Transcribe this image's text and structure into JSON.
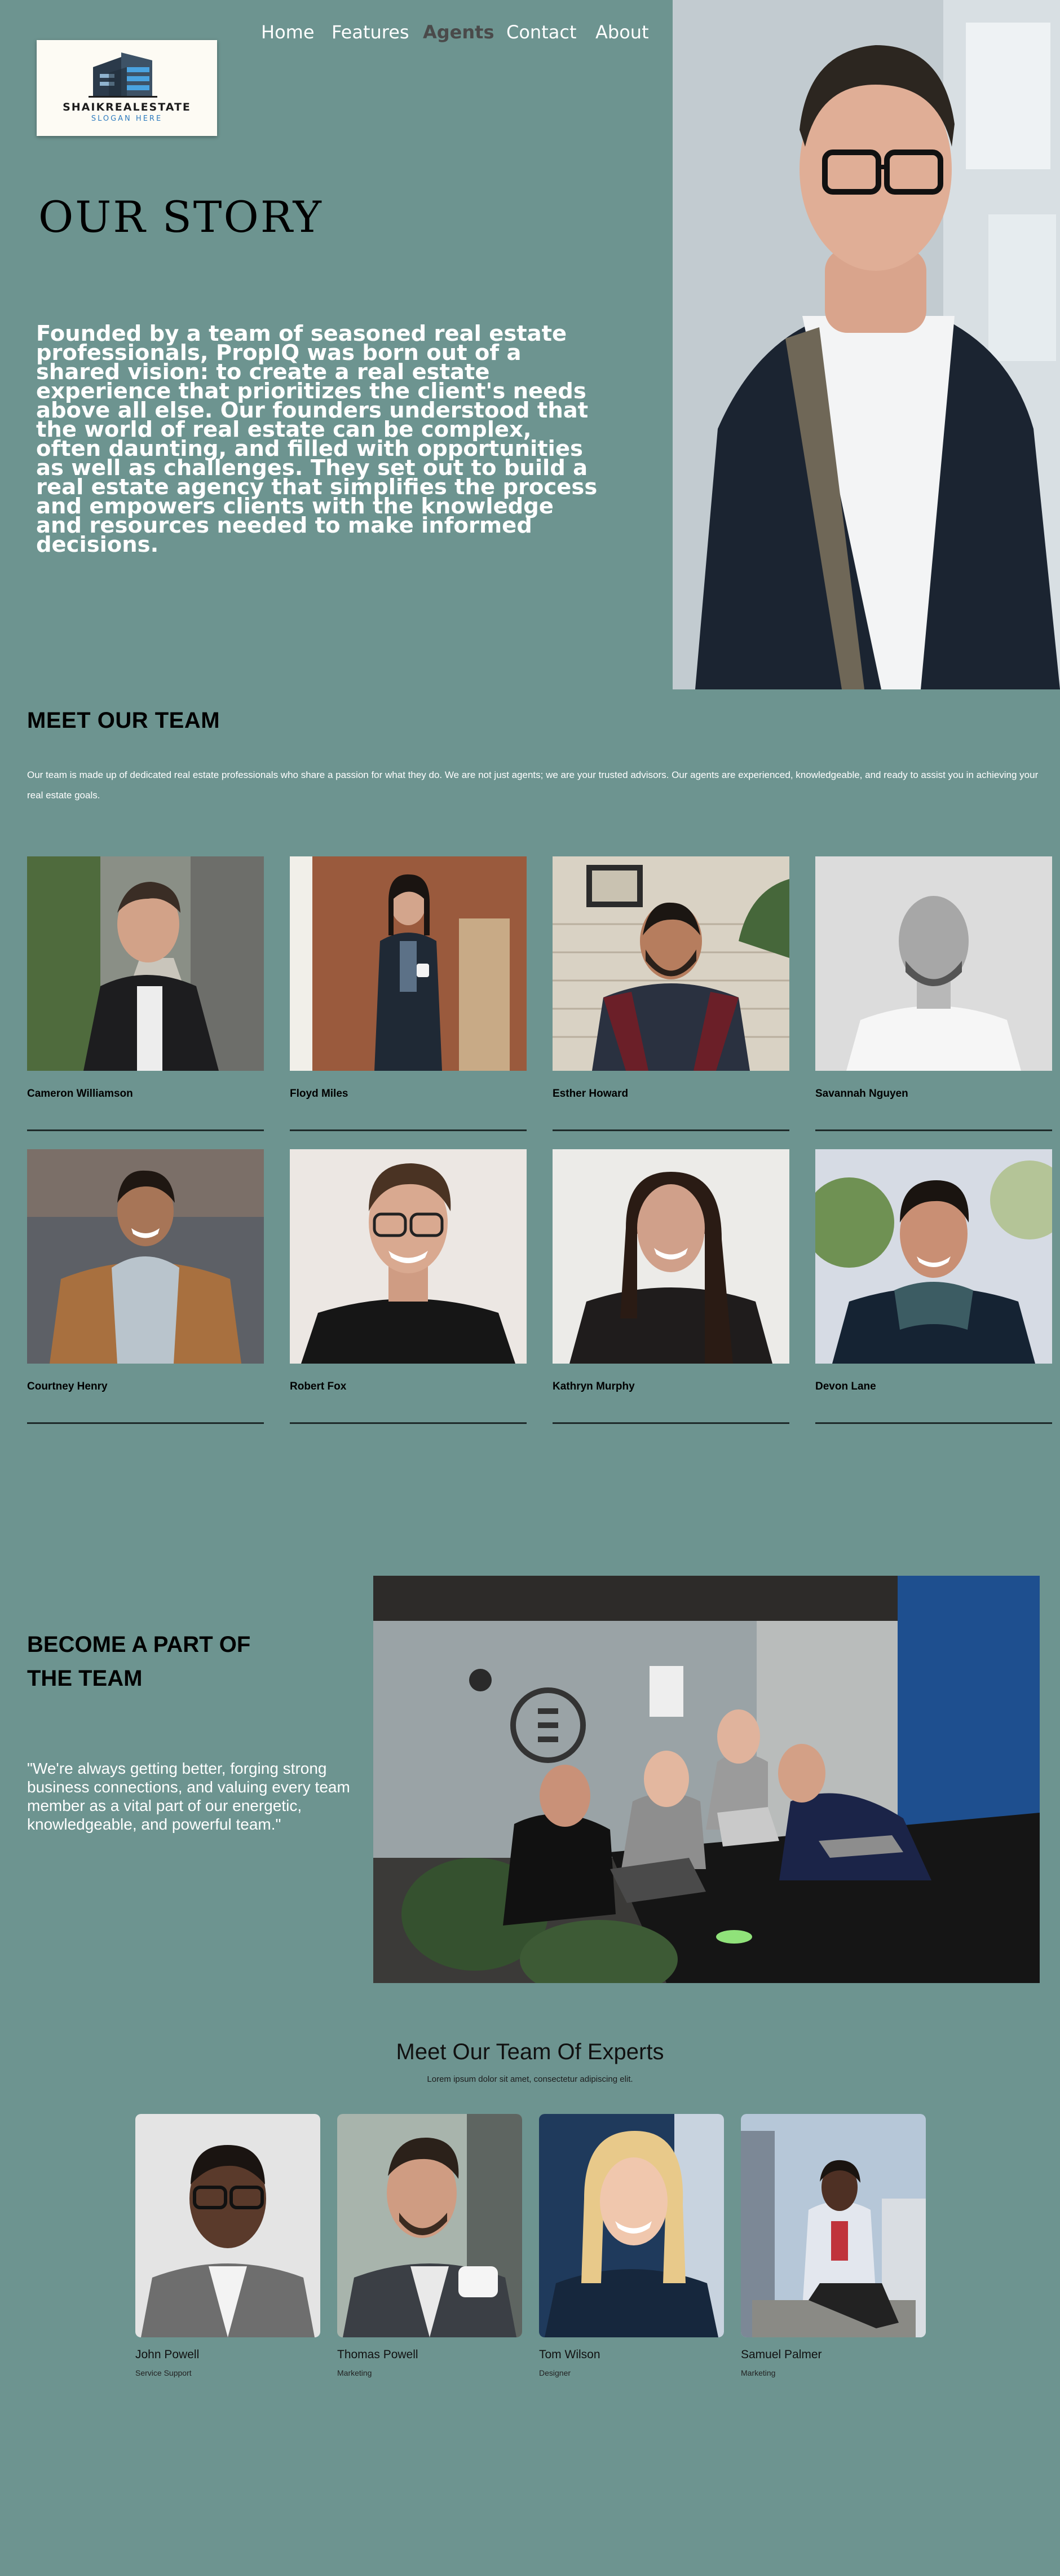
{
  "brand": {
    "name": "SHAIKREALESTATE",
    "slogan": "SLOGAN HERE"
  },
  "nav": {
    "items": [
      {
        "label": "Home",
        "active": false
      },
      {
        "label": "Features",
        "active": false
      },
      {
        "label": "Agents",
        "active": true
      },
      {
        "label": "Contact",
        "active": false
      },
      {
        "label": "About",
        "active": false
      }
    ]
  },
  "hero": {
    "title": "OUR STORY",
    "text": "Founded by a team of seasoned real estate professionals, PropIQ was born out of a shared vision: to create a real estate experience that prioritizes the client's needs above all else. Our founders understood that the world of real estate can be complex, often daunting, and filled with opportunities as well as challenges. They set out to build a real estate agency that simplifies the process and empowers clients with the knowledge and resources needed to make informed decisions."
  },
  "team": {
    "title": "MEET OUR TEAM",
    "description": "Our team is made up of dedicated real estate professionals who share a passion for what they do. We are not just agents; we are your trusted advisors. Our agents are experienced, knowledgeable, and ready to assist you in achieving your real estate goals.",
    "agents": [
      {
        "name": "Cameron Williamson"
      },
      {
        "name": "Floyd Miles"
      },
      {
        "name": "Esther Howard"
      },
      {
        "name": "Savannah Nguyen"
      },
      {
        "name": "Courtney Henry"
      },
      {
        "name": "Robert Fox"
      },
      {
        "name": "Kathryn Murphy"
      },
      {
        "name": "Devon Lane"
      }
    ]
  },
  "join": {
    "title": "BECOME A PART OF THE TEAM",
    "quote": "\"We're always getting better, forging strong business connections, and valuing every team member as a vital part of our energetic, knowledgeable, and powerful team.\""
  },
  "experts": {
    "title": "Meet Our Team Of Experts",
    "subtitle": "Lorem ipsum dolor sit amet, consectetur adipiscing elit.",
    "members": [
      {
        "name": "John Powell",
        "role": "Service Support"
      },
      {
        "name": "Thomas Powell",
        "role": "Marketing"
      },
      {
        "name": "Tom Wilson",
        "role": "Designer"
      },
      {
        "name": "Samuel Palmer",
        "role": "Marketing"
      }
    ]
  },
  "colors": {
    "background": "#6d9490",
    "logo_blue": "#2e7bbf",
    "active_nav": "#4a4a4a",
    "rule": "#1e2a2a"
  }
}
